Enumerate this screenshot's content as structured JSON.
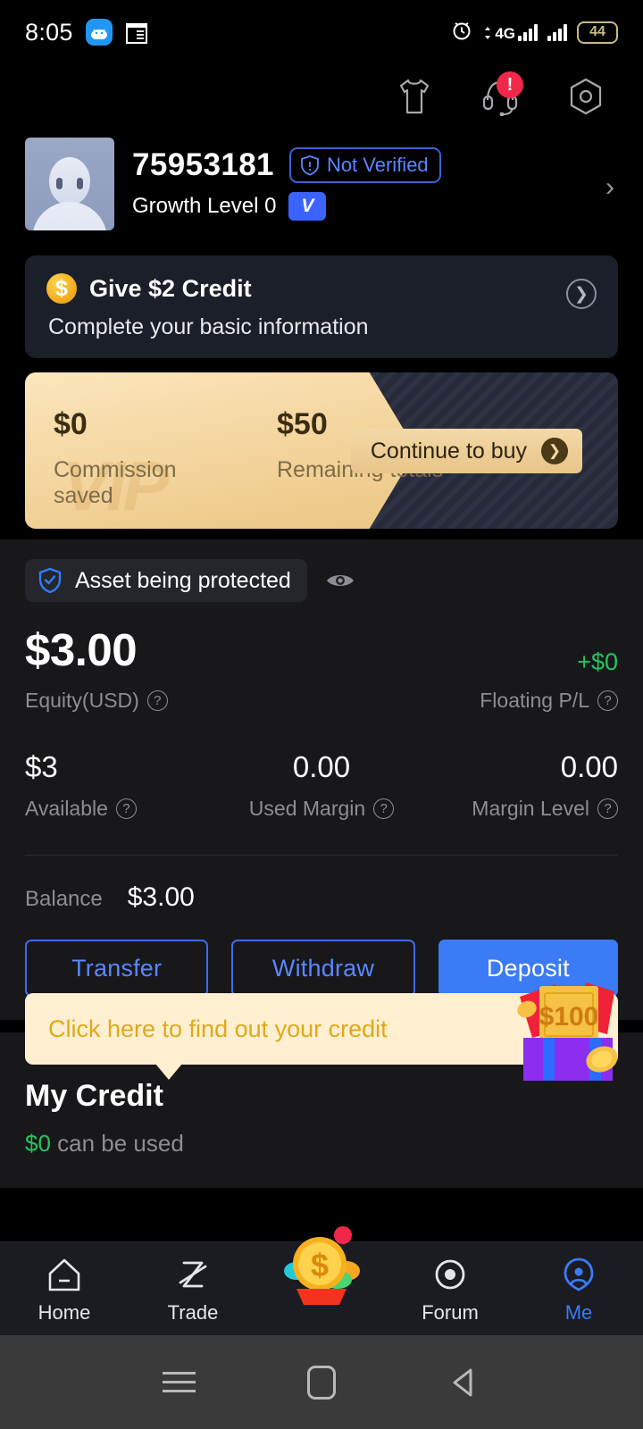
{
  "statusbar": {
    "time": "8:05",
    "network_label": "4G",
    "battery_level": "44",
    "icons": [
      "android-icon",
      "notepad-icon",
      "alarm-icon",
      "signal-icon",
      "battery-icon"
    ]
  },
  "header": {
    "icons": [
      {
        "name": "tshirt-icon",
        "badge": ""
      },
      {
        "name": "headset-support-icon",
        "badge": "!"
      },
      {
        "name": "hexagon-settings-icon",
        "badge": ""
      }
    ]
  },
  "profile": {
    "user_id": "75953181",
    "verify_label": "Not Verified",
    "growth_label": "Growth Level 0",
    "vip_badge": "V"
  },
  "credit_card": {
    "title": "Give $2 Credit",
    "subtitle": "Complete your basic information",
    "coin_symbol": "$"
  },
  "vip_banner": {
    "watermark": "VIP",
    "stat1_value": "$0",
    "stat1_label": "Commission saved",
    "stat2_value": "$50",
    "stat2_label": "Remaining totals",
    "button_label": "Continue to buy"
  },
  "asset": {
    "protect_label": "Asset being protected",
    "equity_value": "$3.00",
    "equity_label": "Equity(USD)",
    "pl_value": "+$0",
    "pl_label": "Floating P/L",
    "metrics": [
      {
        "value": "$3",
        "label": "Available"
      },
      {
        "value": "0.00",
        "label": "Used Margin"
      },
      {
        "value": "0.00",
        "label": "Margin Level"
      }
    ],
    "balance_label": "Balance",
    "balance_value": "$3.00",
    "buttons": [
      {
        "label": "Transfer",
        "style": "outline"
      },
      {
        "label": "Withdraw",
        "style": "outline"
      },
      {
        "label": "Deposit",
        "style": "filled"
      }
    ]
  },
  "credit_section": {
    "tooltip": "Click here to find out your credit",
    "gift_amount": "$100",
    "heading": "My Credit",
    "amount": "$0",
    "amount_suffix": " can be used"
  },
  "bottom_nav": {
    "items": [
      {
        "label": "Home",
        "icon": "home-icon",
        "active": false
      },
      {
        "label": "Trade",
        "icon": "trade-icon",
        "active": false
      },
      {
        "label": "",
        "icon": "coin-plant-icon",
        "active": false
      },
      {
        "label": "Forum",
        "icon": "forum-icon",
        "active": false
      },
      {
        "label": "Me",
        "icon": "person-icon",
        "active": true
      }
    ]
  },
  "android_nav": {
    "buttons": [
      "recents-icon",
      "home-square-icon",
      "back-triangle-icon"
    ]
  },
  "colors": {
    "accent_blue": "#3b7bf6",
    "gold": "#e8c488",
    "green": "#22c55e",
    "badge_red": "#f2284b",
    "panel_bg": "#18181a"
  }
}
